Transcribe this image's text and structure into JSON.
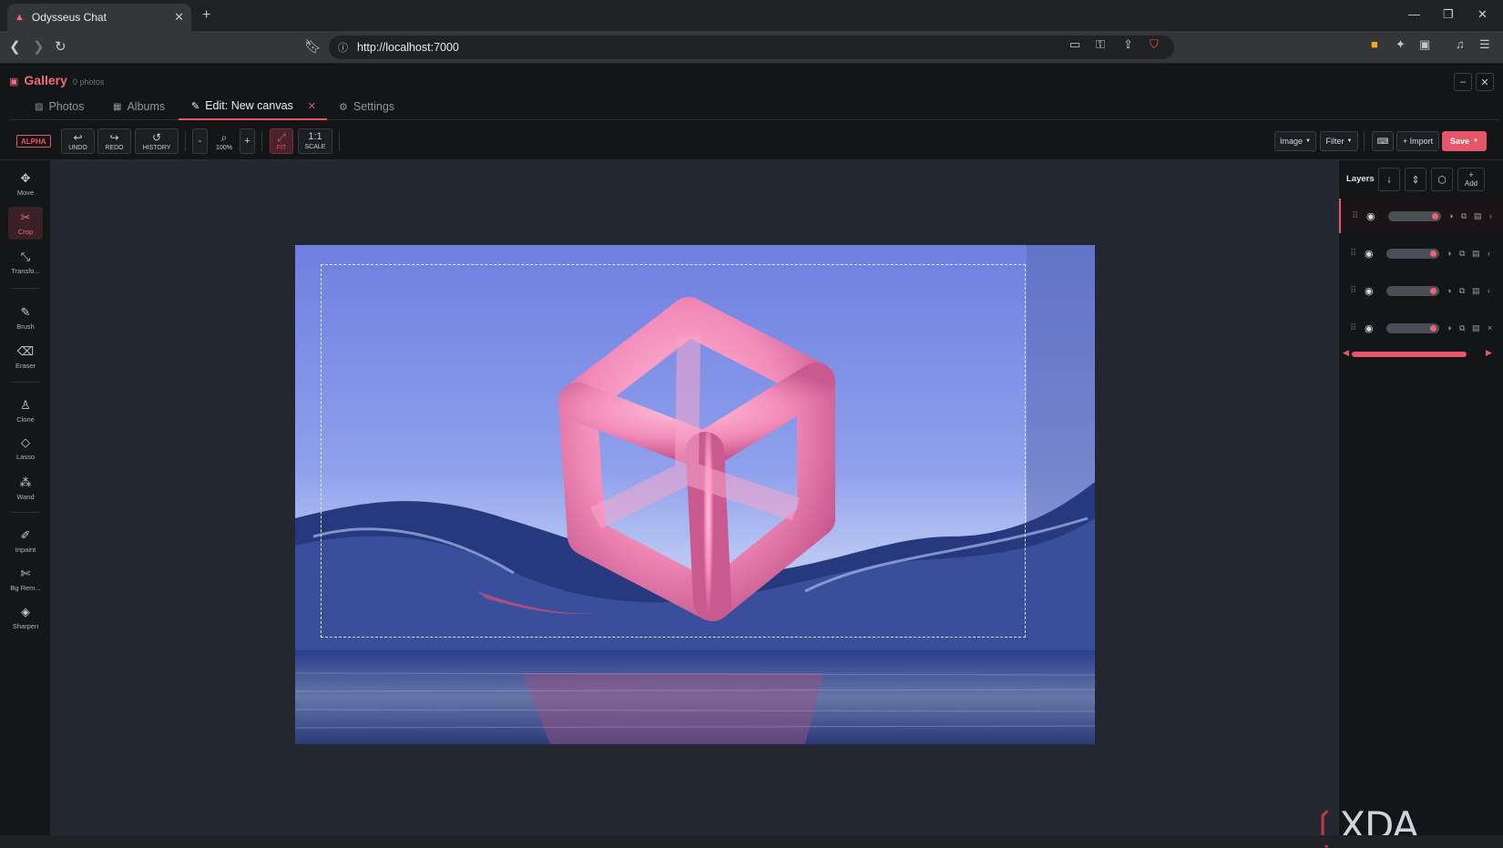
{
  "browser": {
    "tab_title": "Odysseus Chat",
    "new_tab_icon": "+",
    "url": "http://localhost:7000"
  },
  "app": {
    "title": "Gallery",
    "count": "0 photos",
    "tabs": [
      {
        "label": "Photos"
      },
      {
        "label": "Albums"
      },
      {
        "label": "Edit: New canvas"
      },
      {
        "label": "Settings"
      }
    ]
  },
  "toolbar": {
    "badge": "ALPHA",
    "undo": "UNDO",
    "redo": "REDO",
    "history": "HISTORY",
    "zoom_out": "-",
    "zoom_level": "100%",
    "zoom_in": "+",
    "fit": "FIT",
    "scale_icon": "1:1",
    "scale": "SCALE",
    "image_menu": "Image",
    "filter_menu": "Filter",
    "import": "+ Import",
    "save": "Save"
  },
  "tools": [
    {
      "label": "Move",
      "icon": "move-icon"
    },
    {
      "label": "Crop",
      "icon": "scissors-icon"
    },
    {
      "label": "Transfo...",
      "icon": "transform-icon"
    },
    {
      "label": "Brush",
      "icon": "brush-icon"
    },
    {
      "label": "Eraser",
      "icon": "eraser-icon"
    },
    {
      "label": "Clone",
      "icon": "clone-icon"
    },
    {
      "label": "Lasso",
      "icon": "lasso-icon"
    },
    {
      "label": "Wand",
      "icon": "wand-icon"
    },
    {
      "label": "Inpaint",
      "icon": "inpaint-icon"
    },
    {
      "label": "Bg Rem...",
      "icon": "bg-remove-icon"
    },
    {
      "label": "Sharpen",
      "icon": "sharpen-icon"
    }
  ],
  "layers": {
    "title": "Layers",
    "add": "Add",
    "rows": [
      {
        "visible": true,
        "opacity": 1.0,
        "active": true
      },
      {
        "visible": true,
        "opacity": 1.0,
        "active": false
      },
      {
        "visible": true,
        "opacity": 1.0,
        "active": false
      },
      {
        "visible": true,
        "opacity": 1.0,
        "active": false
      }
    ]
  },
  "watermark": "XDA",
  "colors": {
    "accent": "#e5566a",
    "panel": "#141517",
    "canvas_bg": "#23272f"
  }
}
